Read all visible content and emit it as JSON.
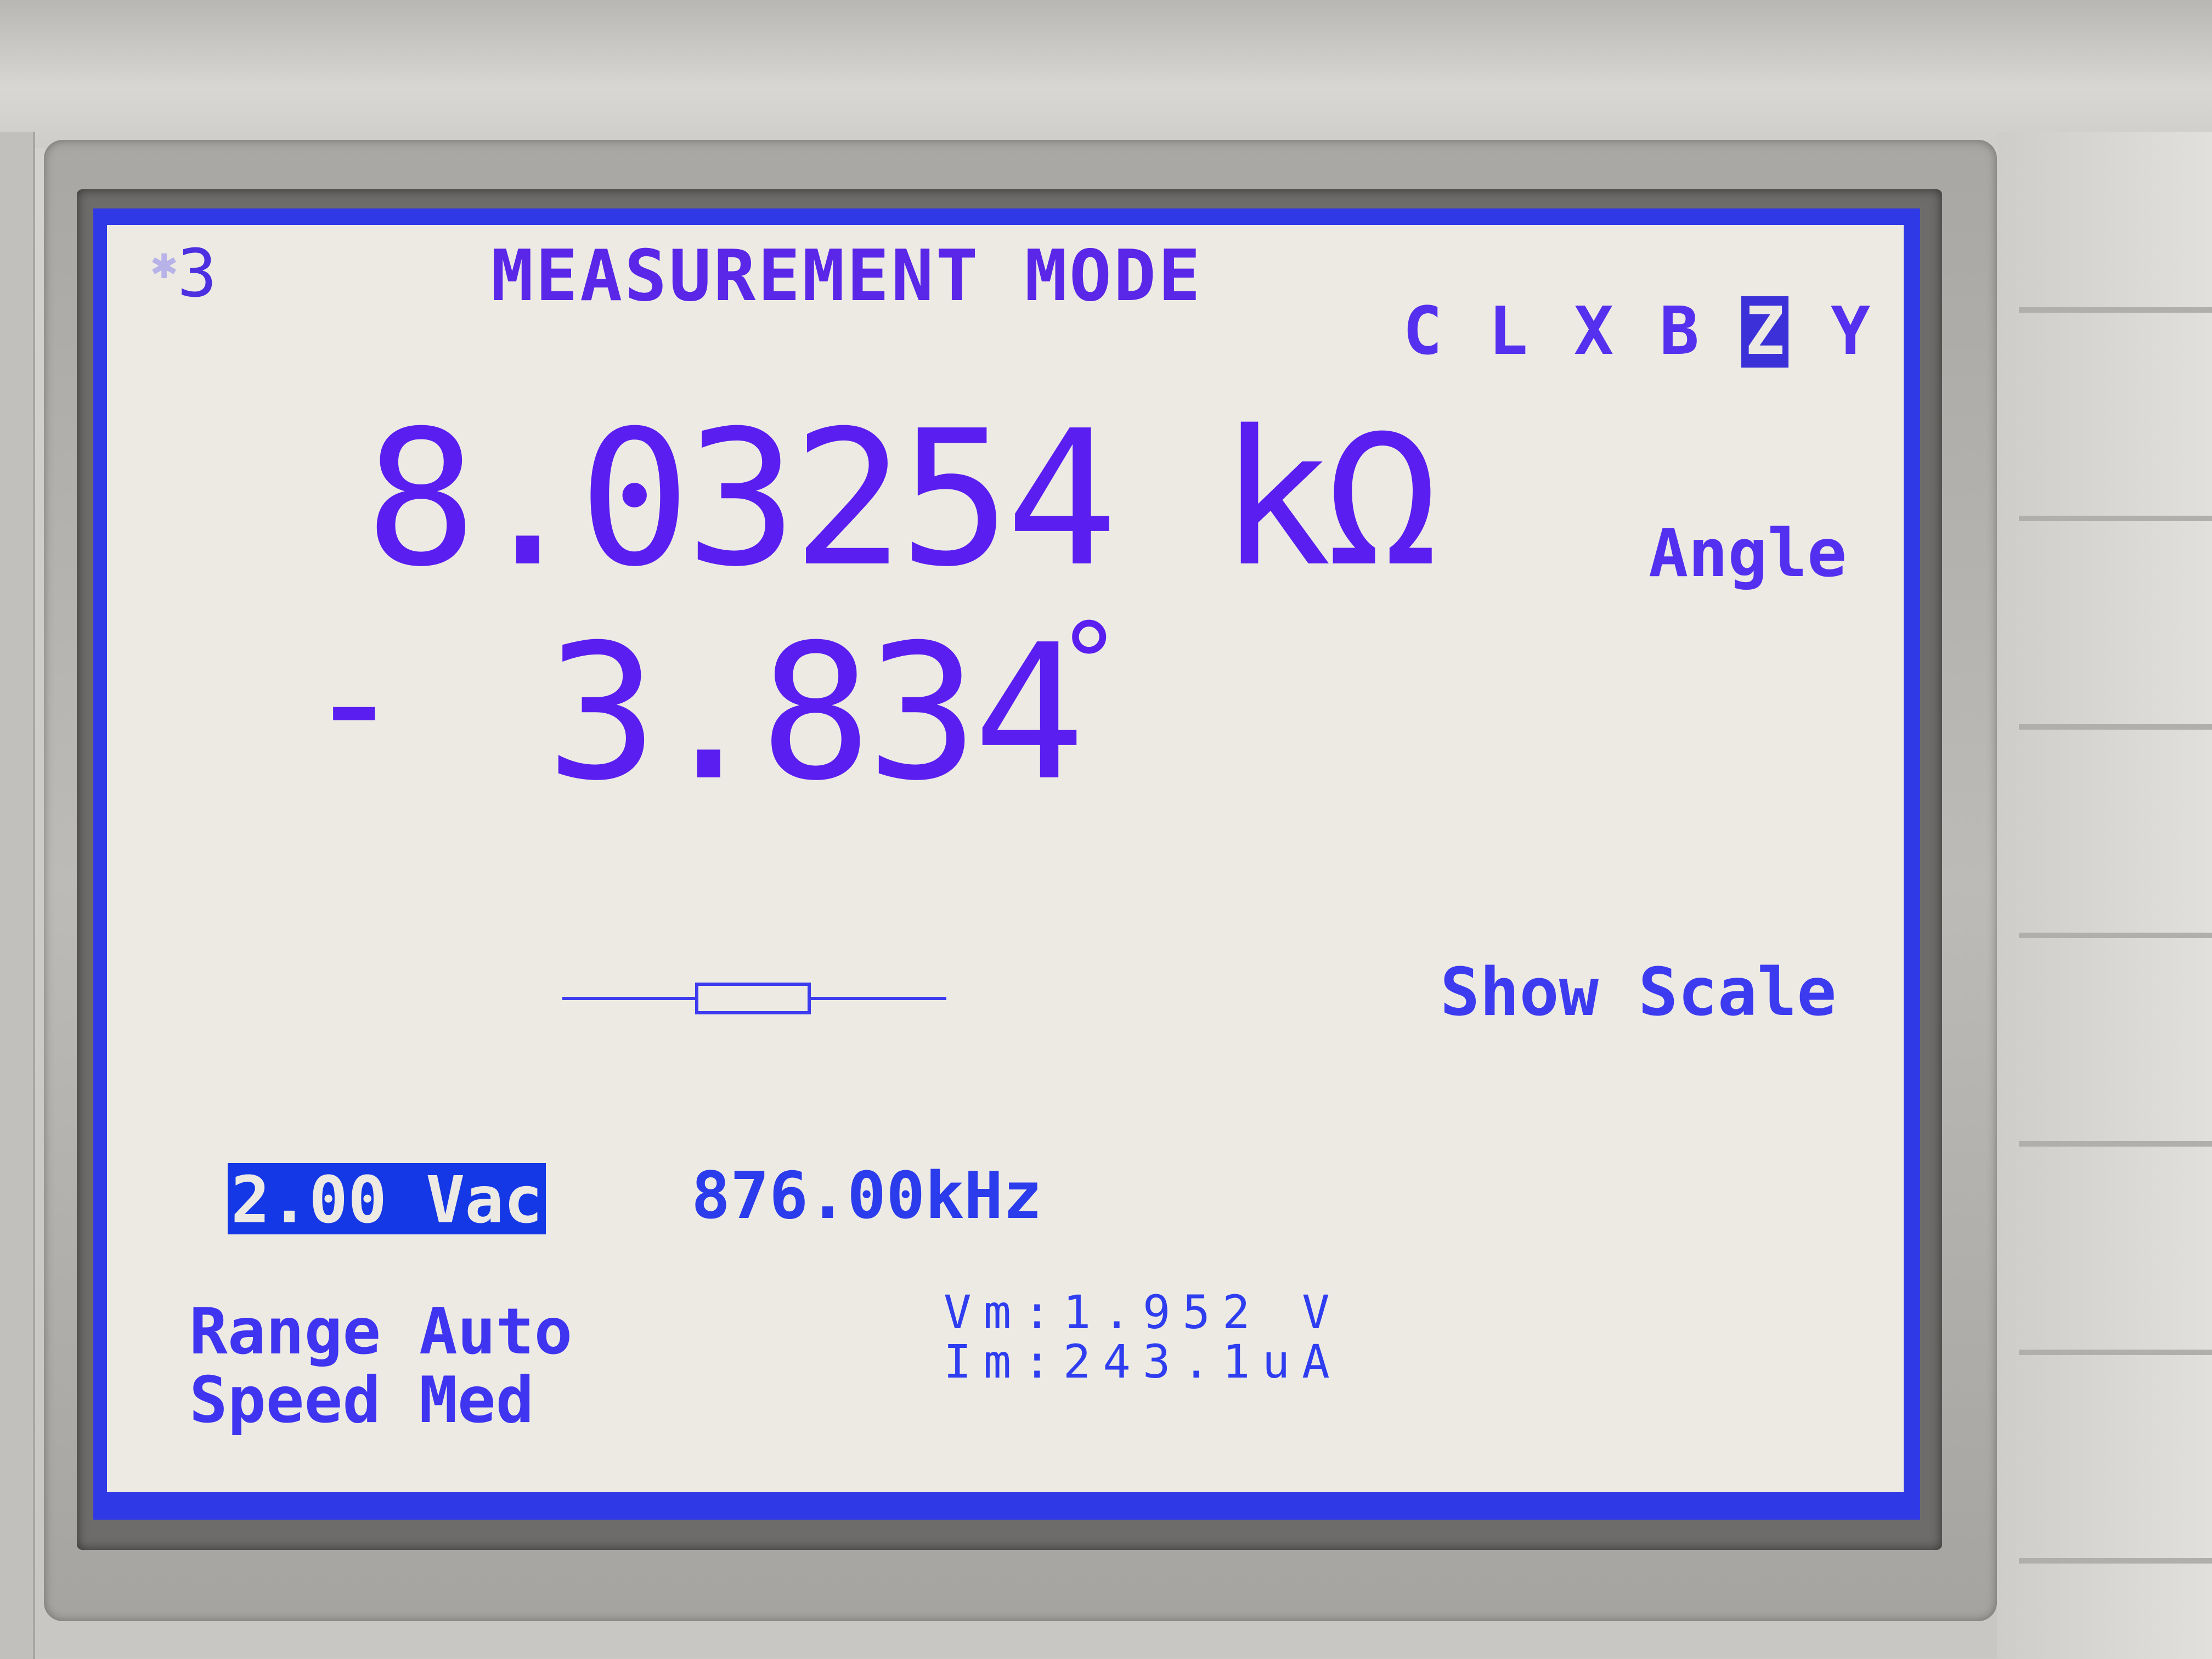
{
  "header": {
    "page_number": "3",
    "title": "MEASUREMENT MODE"
  },
  "parameters": {
    "items": [
      "C",
      "L",
      "X",
      "B",
      "Z",
      "Y"
    ],
    "selected": "Z"
  },
  "primary_reading": {
    "value": "8.03254",
    "unit": "kΩ"
  },
  "secondary_reading": {
    "sign": "-",
    "value": "3.834",
    "unit": "°"
  },
  "softkeys": {
    "secondary_param": "Angle",
    "scale": "Show Scale"
  },
  "equivalent_circuit_icon": "resistor-icon",
  "drive": {
    "voltage": "2.00 Vac",
    "frequency": "876.00kHz"
  },
  "settings": {
    "range": "Range Auto",
    "speed": "Speed Med"
  },
  "monitor": {
    "vm": "Vm:1.952 V",
    "im": "Im:243.1uA"
  },
  "colors": {
    "lcd_background": "#eceae3",
    "lcd_frame": "#2f3ae6",
    "text": "#5a1ff0",
    "highlight": "#1438e6"
  }
}
